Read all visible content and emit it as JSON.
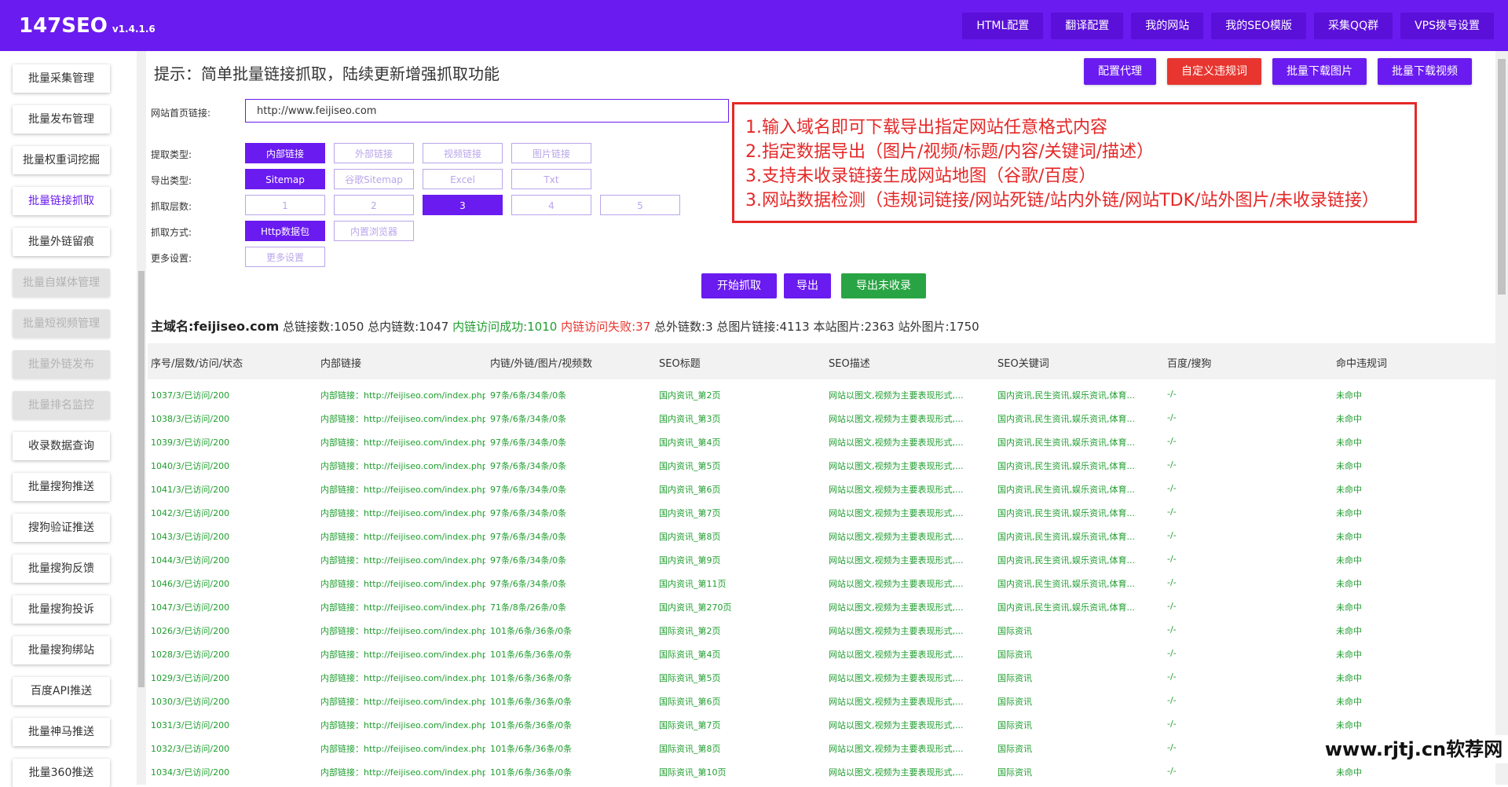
{
  "app": {
    "title": "147SEO",
    "version": "v1.4.1.6"
  },
  "topnav": [
    "HTML配置",
    "翻译配置",
    "我的网站",
    "我的SEO模版",
    "采集QQ群",
    "VPS拨号设置"
  ],
  "sidebar": [
    {
      "label": "批量采集管理",
      "state": "normal"
    },
    {
      "label": "批量发布管理",
      "state": "normal"
    },
    {
      "label": "批量权重词挖掘",
      "state": "normal"
    },
    {
      "label": "批量链接抓取",
      "state": "active"
    },
    {
      "label": "批量外链留痕",
      "state": "normal"
    },
    {
      "label": "批量自媒体管理",
      "state": "disabled"
    },
    {
      "label": "批量短视频管理",
      "state": "disabled"
    },
    {
      "label": "批量外链发布",
      "state": "disabled"
    },
    {
      "label": "批量排名监控",
      "state": "disabled"
    },
    {
      "label": "收录数据查询",
      "state": "normal"
    },
    {
      "label": "批量搜狗推送",
      "state": "normal"
    },
    {
      "label": "搜狗验证推送",
      "state": "normal"
    },
    {
      "label": "批量搜狗反馈",
      "state": "normal"
    },
    {
      "label": "批量搜狗投诉",
      "state": "normal"
    },
    {
      "label": "批量搜狗绑站",
      "state": "normal"
    },
    {
      "label": "百度API推送",
      "state": "normal"
    },
    {
      "label": "批量神马推送",
      "state": "normal"
    },
    {
      "label": "批量360推送",
      "state": "normal"
    }
  ],
  "tip": "提示：简单批量链接抓取，陆续更新增强抓取功能",
  "actions": {
    "proxy": "配置代理",
    "custom_words": "自定义违规词",
    "dl_images": "批量下载图片",
    "dl_videos": "批量下载视频"
  },
  "form": {
    "url_label": "网站首页链接:",
    "url_value": "http://www.feijiseo.com",
    "type_label": "提取类型:",
    "type_options": [
      {
        "label": "内部链接",
        "selected": true
      },
      {
        "label": "外部链接",
        "selected": false
      },
      {
        "label": "视频链接",
        "selected": false
      },
      {
        "label": "图片链接",
        "selected": false
      }
    ],
    "export_label": "导出类型:",
    "export_options": [
      {
        "label": "Sitemap",
        "selected": true
      },
      {
        "label": "谷歌Sitemap",
        "selected": false
      },
      {
        "label": "Excel",
        "selected": false
      },
      {
        "label": "Txt",
        "selected": false
      }
    ],
    "depth_label": "抓取层数:",
    "depth_options": [
      {
        "label": "1",
        "selected": false
      },
      {
        "label": "2",
        "selected": false
      },
      {
        "label": "3",
        "selected": true
      },
      {
        "label": "4",
        "selected": false
      },
      {
        "label": "5",
        "selected": false
      }
    ],
    "method_label": "抓取方式:",
    "method_options": [
      {
        "label": "Http数据包",
        "selected": true
      },
      {
        "label": "内置浏览器",
        "selected": false
      }
    ],
    "more_label": "更多设置:",
    "more_button": "更多设置"
  },
  "buttons": {
    "start": "开始抓取",
    "export": "导出",
    "export_unindexed": "导出未收录"
  },
  "info_lines": [
    "1.输入域名即可下载导出指定网站任意格式内容",
    "2.指定数据导出（图片/视频/标题/内容/关键词/描述）",
    "3.支持未收录链接生成网站地图（谷歌/百度）",
    "3.网站数据检测（违规词链接/网站死链/站内外链/网站TDK/站外图片/未收录链接）"
  ],
  "stats": {
    "host": "主域名:feijiseo.com",
    "total_links": "总链接数:1050",
    "internal": "总内链数:1047",
    "ok": "内链访问成功:1010",
    "fail": "内链访问失败:37",
    "external": "总外链数:3",
    "images": "总图片链接:4113",
    "local_images": "本站图片:2363",
    "remote_images": "站外图片:1750"
  },
  "table": {
    "headers": [
      "序号/层数/访问/状态",
      "内部链接",
      "内链/外链/图片/视频数",
      "SEO标题",
      "SEO描述",
      "SEO关键词",
      "百度/搜狗",
      "命中违规词"
    ],
    "rows": [
      [
        "1037/3/已访问/200",
        "内部链接：http://feijiseo.com/index.php",
        "97条/6条/34条/0条",
        "国内资讯_第2页",
        "网站以图文,视频为主要表现形式,...",
        "国内资讯,民生资讯,娱乐资讯,体育...",
        "-/-",
        "未命中"
      ],
      [
        "1038/3/已访问/200",
        "内部链接：http://feijiseo.com/index.php",
        "97条/6条/34条/0条",
        "国内资讯_第3页",
        "网站以图文,视频为主要表现形式,...",
        "国内资讯,民生资讯,娱乐资讯,体育...",
        "-/-",
        "未命中"
      ],
      [
        "1039/3/已访问/200",
        "内部链接：http://feijiseo.com/index.php",
        "97条/6条/34条/0条",
        "国内资讯_第4页",
        "网站以图文,视频为主要表现形式,...",
        "国内资讯,民生资讯,娱乐资讯,体育...",
        "-/-",
        "未命中"
      ],
      [
        "1040/3/已访问/200",
        "内部链接：http://feijiseo.com/index.php",
        "97条/6条/34条/0条",
        "国内资讯_第5页",
        "网站以图文,视频为主要表现形式,...",
        "国内资讯,民生资讯,娱乐资讯,体育...",
        "-/-",
        "未命中"
      ],
      [
        "1041/3/已访问/200",
        "内部链接：http://feijiseo.com/index.php",
        "97条/6条/34条/0条",
        "国内资讯_第6页",
        "网站以图文,视频为主要表现形式,...",
        "国内资讯,民生资讯,娱乐资讯,体育...",
        "-/-",
        "未命中"
      ],
      [
        "1042/3/已访问/200",
        "内部链接：http://feijiseo.com/index.php",
        "97条/6条/34条/0条",
        "国内资讯_第7页",
        "网站以图文,视频为主要表现形式,...",
        "国内资讯,民生资讯,娱乐资讯,体育...",
        "-/-",
        "未命中"
      ],
      [
        "1043/3/已访问/200",
        "内部链接：http://feijiseo.com/index.php",
        "97条/6条/34条/0条",
        "国内资讯_第8页",
        "网站以图文,视频为主要表现形式,...",
        "国内资讯,民生资讯,娱乐资讯,体育...",
        "-/-",
        "未命中"
      ],
      [
        "1044/3/已访问/200",
        "内部链接：http://feijiseo.com/index.php",
        "97条/6条/34条/0条",
        "国内资讯_第9页",
        "网站以图文,视频为主要表现形式,...",
        "国内资讯,民生资讯,娱乐资讯,体育...",
        "-/-",
        "未命中"
      ],
      [
        "1046/3/已访问/200",
        "内部链接：http://feijiseo.com/index.php",
        "97条/6条/34条/0条",
        "国内资讯_第11页",
        "网站以图文,视频为主要表现形式,...",
        "国内资讯,民生资讯,娱乐资讯,体育...",
        "-/-",
        "未命中"
      ],
      [
        "1047/3/已访问/200",
        "内部链接：http://feijiseo.com/index.php",
        "71条/8条/26条/0条",
        "国内资讯_第270页",
        "网站以图文,视频为主要表现形式,...",
        "国内资讯,民生资讯,娱乐资讯,体育...",
        "-/-",
        "未命中"
      ],
      [
        "1026/3/已访问/200",
        "内部链接：http://feijiseo.com/index.php",
        "101条/6条/36条/0条",
        "国际资讯_第2页",
        "网站以图文,视频为主要表现形式,...",
        "国际资讯",
        "-/-",
        "未命中"
      ],
      [
        "1028/3/已访问/200",
        "内部链接：http://feijiseo.com/index.php",
        "101条/6条/36条/0条",
        "国际资讯_第4页",
        "网站以图文,视频为主要表现形式,...",
        "国际资讯",
        "-/-",
        "未命中"
      ],
      [
        "1029/3/已访问/200",
        "内部链接：http://feijiseo.com/index.php",
        "101条/6条/36条/0条",
        "国际资讯_第5页",
        "网站以图文,视频为主要表现形式,...",
        "国际资讯",
        "-/-",
        "未命中"
      ],
      [
        "1030/3/已访问/200",
        "内部链接：http://feijiseo.com/index.php",
        "101条/6条/36条/0条",
        "国际资讯_第6页",
        "网站以图文,视频为主要表现形式,...",
        "国际资讯",
        "-/-",
        "未命中"
      ],
      [
        "1031/3/已访问/200",
        "内部链接：http://feijiseo.com/index.php",
        "101条/6条/36条/0条",
        "国际资讯_第7页",
        "网站以图文,视频为主要表现形式,...",
        "国际资讯",
        "-/-",
        "未命中"
      ],
      [
        "1032/3/已访问/200",
        "内部链接：http://feijiseo.com/index.php",
        "101条/6条/36条/0条",
        "国际资讯_第8页",
        "网站以图文,视频为主要表现形式,...",
        "国际资讯",
        "-/-",
        "未命中"
      ],
      [
        "1034/3/已访问/200",
        "内部链接：http://feijiseo.com/index.php",
        "101条/6条/36条/0条",
        "国际资讯_第10页",
        "网站以图文,视频为主要表现形式,...",
        "国际资讯",
        "-/-",
        "未命中"
      ]
    ]
  },
  "watermark": "www.rjtj.cn软荐网",
  "colors": {
    "brand": "#6a1bf0",
    "danger": "#e8352f",
    "success": "#1f9e2f",
    "warning_box": "#e52828",
    "option_border": "#b9a6ea"
  }
}
